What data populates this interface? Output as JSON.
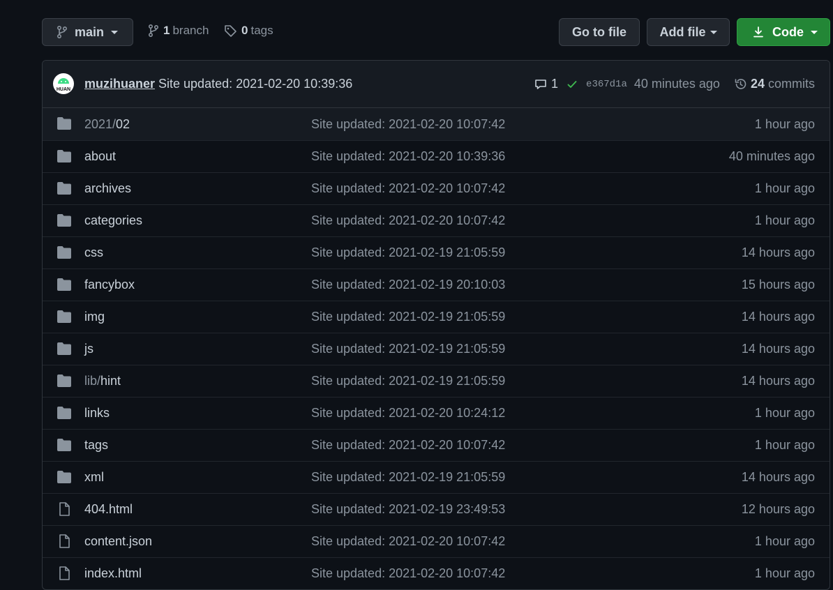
{
  "branch_button": {
    "label": "main"
  },
  "branches": {
    "count": "1",
    "label": "branch"
  },
  "tags": {
    "count": "0",
    "label": "tags"
  },
  "go_to_file": {
    "label": "Go to file"
  },
  "add_file": {
    "label": "Add file"
  },
  "code_button": {
    "label": "Code"
  },
  "commit": {
    "author": "muzihuaner",
    "message": "Site updated: 2021-02-20 10:39:36",
    "comment_count": "1",
    "sha": "e367d1a",
    "time": "40 minutes ago",
    "commits_count": "24",
    "commits_label": "commits",
    "avatar_text": "HUAN"
  },
  "files": [
    {
      "type": "dir",
      "prefix": "2021/",
      "name": "02",
      "message": "Site updated: 2021-02-20 10:07:42",
      "age": "1 hour ago"
    },
    {
      "type": "dir",
      "prefix": "",
      "name": "about",
      "message": "Site updated: 2021-02-20 10:39:36",
      "age": "40 minutes ago"
    },
    {
      "type": "dir",
      "prefix": "",
      "name": "archives",
      "message": "Site updated: 2021-02-20 10:07:42",
      "age": "1 hour ago"
    },
    {
      "type": "dir",
      "prefix": "",
      "name": "categories",
      "message": "Site updated: 2021-02-20 10:07:42",
      "age": "1 hour ago"
    },
    {
      "type": "dir",
      "prefix": "",
      "name": "css",
      "message": "Site updated: 2021-02-19 21:05:59",
      "age": "14 hours ago"
    },
    {
      "type": "dir",
      "prefix": "",
      "name": "fancybox",
      "message": "Site updated: 2021-02-19 20:10:03",
      "age": "15 hours ago"
    },
    {
      "type": "dir",
      "prefix": "",
      "name": "img",
      "message": "Site updated: 2021-02-19 21:05:59",
      "age": "14 hours ago"
    },
    {
      "type": "dir",
      "prefix": "",
      "name": "js",
      "message": "Site updated: 2021-02-19 21:05:59",
      "age": "14 hours ago"
    },
    {
      "type": "dir",
      "prefix": "lib/",
      "name": "hint",
      "message": "Site updated: 2021-02-19 21:05:59",
      "age": "14 hours ago"
    },
    {
      "type": "dir",
      "prefix": "",
      "name": "links",
      "message": "Site updated: 2021-02-20 10:24:12",
      "age": "1 hour ago"
    },
    {
      "type": "dir",
      "prefix": "",
      "name": "tags",
      "message": "Site updated: 2021-02-20 10:07:42",
      "age": "1 hour ago"
    },
    {
      "type": "dir",
      "prefix": "",
      "name": "xml",
      "message": "Site updated: 2021-02-19 21:05:59",
      "age": "14 hours ago"
    },
    {
      "type": "file",
      "prefix": "",
      "name": "404.html",
      "message": "Site updated: 2021-02-19 23:49:53",
      "age": "12 hours ago"
    },
    {
      "type": "file",
      "prefix": "",
      "name": "content.json",
      "message": "Site updated: 2021-02-20 10:07:42",
      "age": "1 hour ago"
    },
    {
      "type": "file",
      "prefix": "",
      "name": "index.html",
      "message": "Site updated: 2021-02-20 10:07:42",
      "age": "1 hour ago"
    }
  ],
  "colors": {
    "background": "#0d1117",
    "accent_green": "#238636",
    "check_green": "#3fb950",
    "folder_icon": "#8b949e"
  }
}
